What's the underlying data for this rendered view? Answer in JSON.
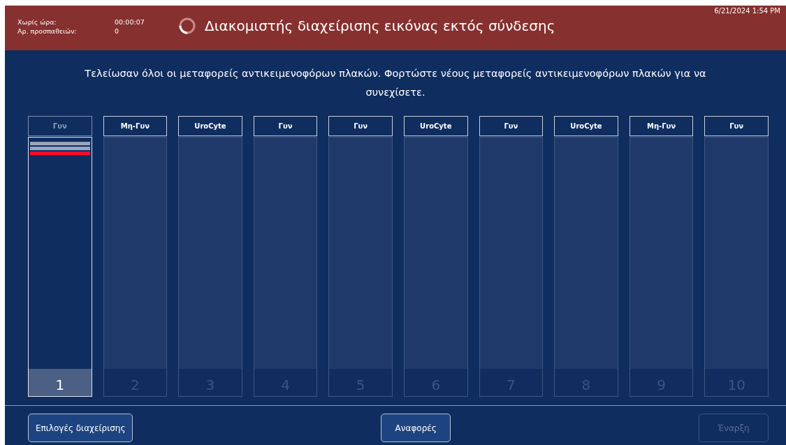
{
  "header": {
    "timer_label": "Χωρίς ώρα:",
    "timer_value": "00:00:07",
    "attempts_label": "Αρ. προσπαθειών:",
    "attempts_value": "0",
    "title": "Διακομιστής διαχείρισης εικόνας εκτός σύνδεσης",
    "datetime": "6/21/2024 1:54 PM"
  },
  "message": "Τελείωσαν όλοι οι μεταφορείς αντικειμενοφόρων πλακών. Φορτώστε νέους μεταφορείς αντικειμενοφόρων πλακών για να συνεχίσετε.",
  "carriers": [
    {
      "label": "Γυν",
      "number": "1",
      "selected": true,
      "slides": [
        {
          "color": "#9aa5bd"
        },
        {
          "color": "#9aa5bd"
        },
        {
          "color": "#ff0a2e"
        }
      ]
    },
    {
      "label": "Μη-Γυν",
      "number": "2",
      "selected": false
    },
    {
      "label": "UroCyte",
      "number": "3",
      "selected": false
    },
    {
      "label": "Γυν",
      "number": "4",
      "selected": false
    },
    {
      "label": "Γυν",
      "number": "5",
      "selected": false
    },
    {
      "label": "UroCyte",
      "number": "6",
      "selected": false
    },
    {
      "label": "Γυν",
      "number": "7",
      "selected": false
    },
    {
      "label": "UroCyte",
      "number": "8",
      "selected": false
    },
    {
      "label": "Μη-Γυν",
      "number": "9",
      "selected": false
    },
    {
      "label": "Γυν",
      "number": "10",
      "selected": false
    }
  ],
  "buttons": [
    {
      "label": "Επιλογές διαχείρισης",
      "disabled": false
    },
    {
      "label": "Αναφορές",
      "disabled": false
    },
    {
      "label": "Έναρξη",
      "disabled": true
    }
  ]
}
